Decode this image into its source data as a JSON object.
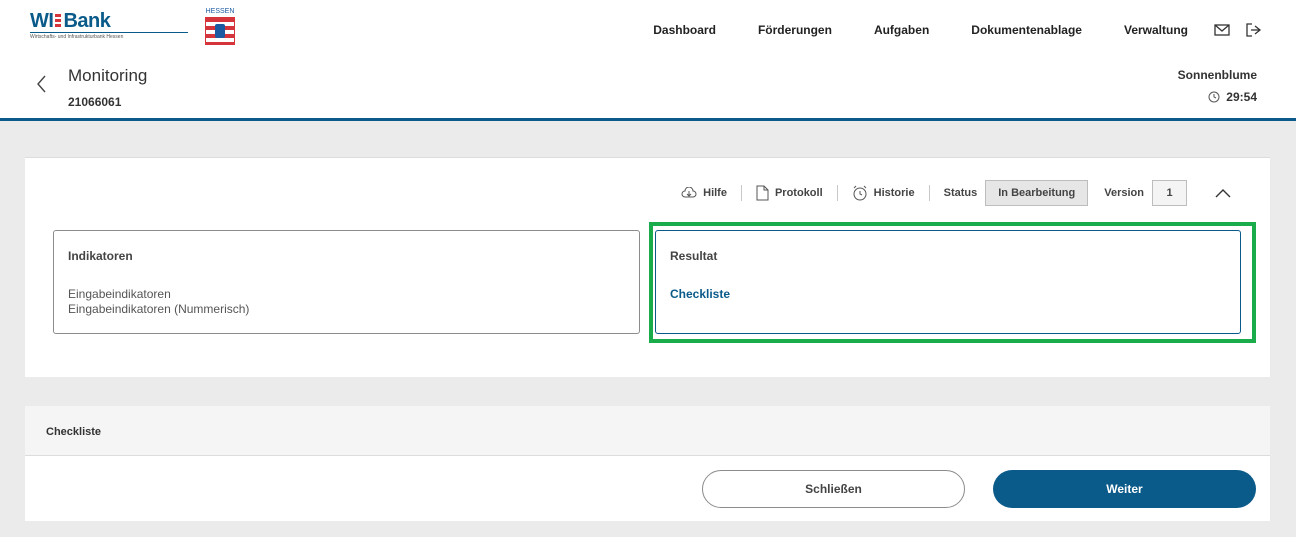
{
  "brand": {
    "logo_text": "WI Bank",
    "logo_subtitle": "Wirtschafts- und Infrastrukturbank Hessen",
    "state_label": "HESSEN"
  },
  "nav": {
    "items": [
      "Dashboard",
      "Förderungen",
      "Aufgaben",
      "Dokumentenablage",
      "Verwaltung"
    ],
    "icons": [
      "mail-icon",
      "logout-icon"
    ]
  },
  "page": {
    "title": "Monitoring",
    "id": "21066061",
    "user": "Sonnenblume",
    "timer": "29:54"
  },
  "toolbar": {
    "help": "Hilfe",
    "protocol": "Protokoll",
    "history": "Historie",
    "status_label": "Status",
    "status_value": "In Bearbeitung",
    "version_label": "Version",
    "version_value": "1"
  },
  "indicators": {
    "title": "Indikatoren",
    "items": [
      "Eingabeindikatoren",
      "Eingabeindikatoren (Nummerisch)"
    ]
  },
  "result": {
    "title": "Resultat",
    "link": "Checkliste"
  },
  "checklist": {
    "title": "Checkliste",
    "close_label": "Schließen",
    "next_label": "Weiter"
  },
  "colors": {
    "brand_blue": "#0a5a8a",
    "highlight_green": "#1aab4b",
    "background_gray": "#ebebeb"
  }
}
